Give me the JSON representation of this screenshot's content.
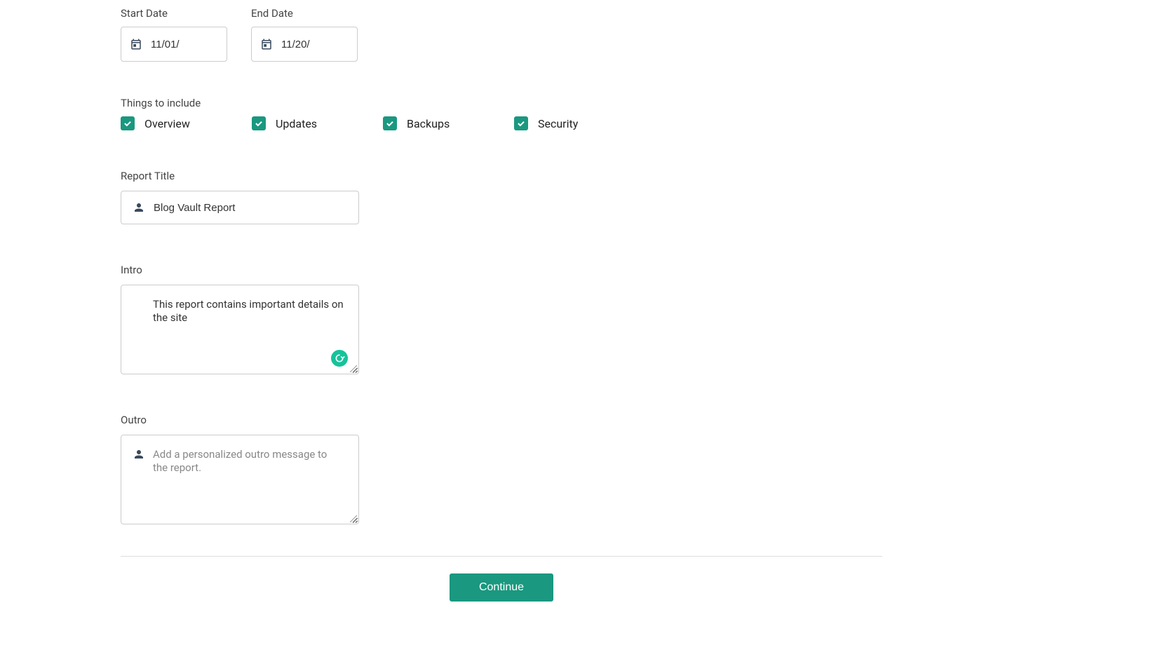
{
  "dates": {
    "start_label": "Start Date",
    "end_label": "End Date",
    "start_value": "11/01/",
    "end_value": "11/20/"
  },
  "things": {
    "label": "Things to include",
    "items": [
      {
        "label": "Overview",
        "checked": true
      },
      {
        "label": "Updates",
        "checked": true
      },
      {
        "label": "Backups",
        "checked": true
      },
      {
        "label": "Security",
        "checked": true
      }
    ]
  },
  "report_title": {
    "label": "Report Title",
    "value": "Blog Vault Report"
  },
  "intro": {
    "label": "Intro",
    "value": "This report contains important details on the site"
  },
  "outro": {
    "label": "Outro",
    "value": "",
    "placeholder": "Add a personalized outro message to the report."
  },
  "buttons": {
    "continue": "Continue"
  }
}
